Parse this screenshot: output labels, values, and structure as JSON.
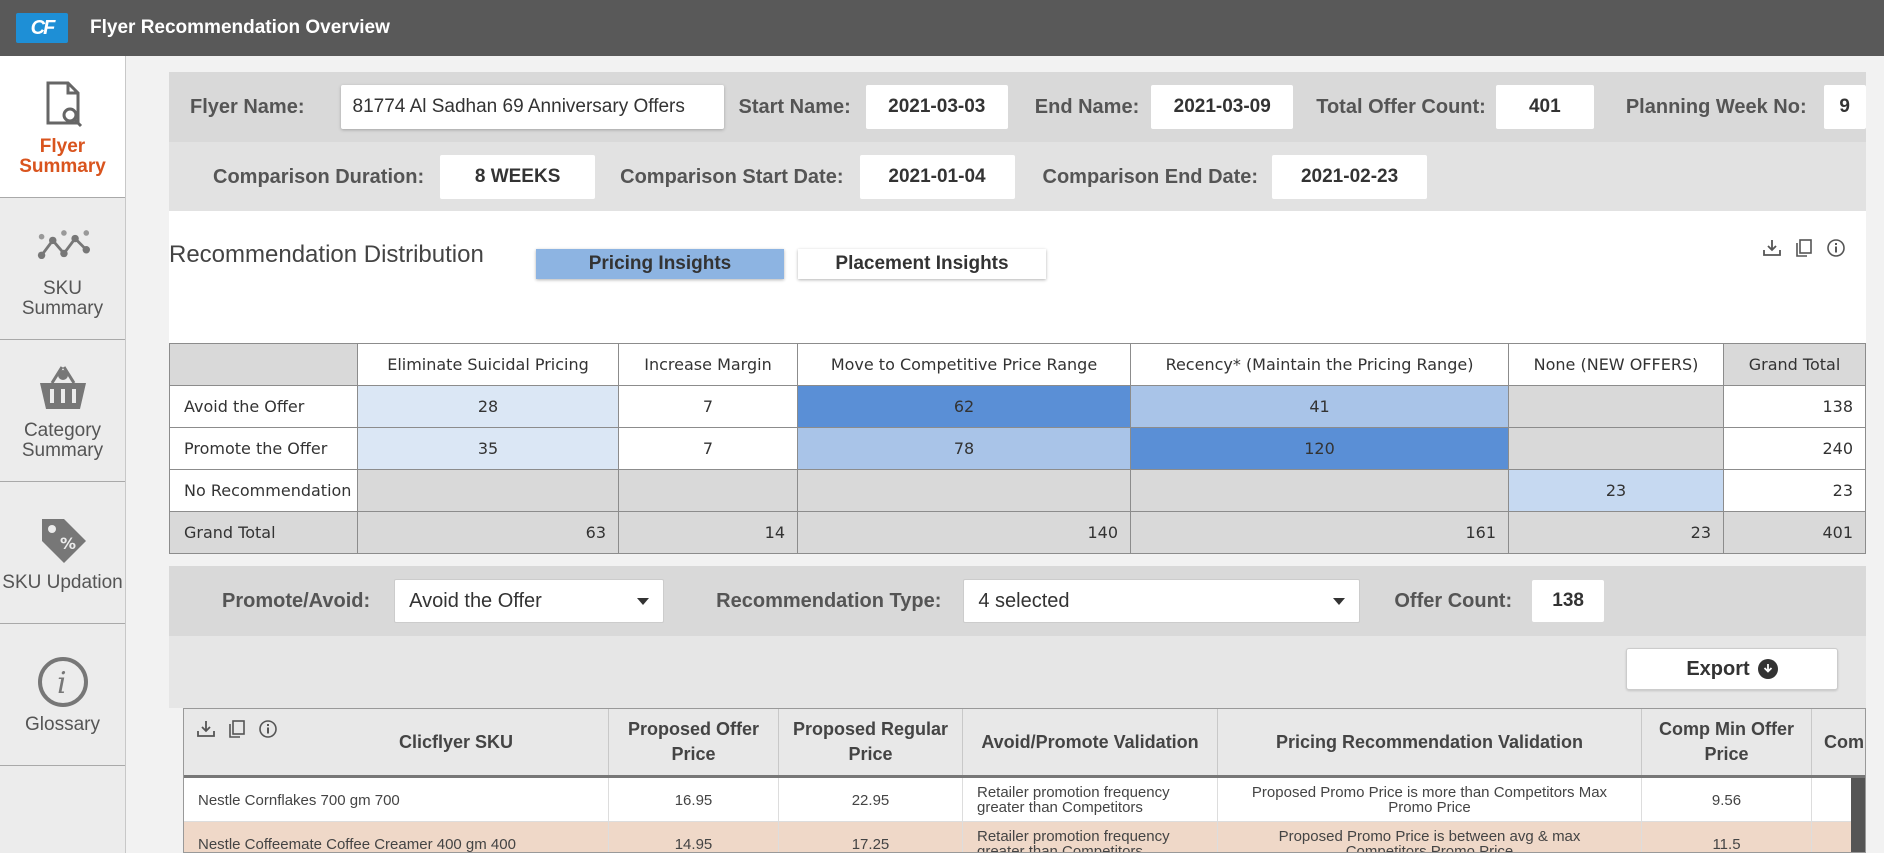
{
  "app": {
    "logo_text": "CF",
    "title": "Flyer Recommendation Overview"
  },
  "sidebar": {
    "items": [
      {
        "label": "Flyer Summary",
        "icon": "document-search-icon",
        "active": true
      },
      {
        "label": "SKU Summary",
        "icon": "network-nodes-icon",
        "active": false
      },
      {
        "label": "Category Summary",
        "icon": "basket-icon",
        "active": false
      },
      {
        "label": "SKU Updation",
        "icon": "price-tag-icon",
        "active": false
      },
      {
        "label": "Glossary",
        "icon": "info-circle-icon",
        "active": false
      }
    ]
  },
  "flyer": {
    "name_label": "Flyer Name:",
    "name_value": "81774 Al Sadhan 69 Anniversary Offers",
    "start_label": "Start Name:",
    "start_value": "2021-03-03",
    "end_label": "End Name:",
    "end_value": "2021-03-09",
    "total_label": "Total Offer Count:",
    "total_value": "401",
    "week_label": "Planning Week No:",
    "week_value": "9"
  },
  "comparison": {
    "duration_label": "Comparison Duration:",
    "duration_value": "8 WEEKS",
    "start_label": "Comparison Start Date:",
    "start_value": "2021-01-04",
    "end_label": "Comparison End Date:",
    "end_value": "2021-02-23"
  },
  "distribution": {
    "title": "Recommendation Distribution",
    "tabs": {
      "pricing": "Pricing Insights",
      "placement": "Placement Insights"
    },
    "columns": [
      "Eliminate Suicidal Pricing",
      "Increase Margin",
      "Move to Competitive Price Range",
      "Recency* (Maintain the Pricing Range)",
      "None (NEW OFFERS)",
      "Grand Total"
    ],
    "rows": [
      {
        "label": "Avoid the Offer",
        "cells": [
          "28",
          "7",
          "62",
          "41",
          "",
          "138"
        ]
      },
      {
        "label": "Promote the Offer",
        "cells": [
          "35",
          "7",
          "78",
          "120",
          "",
          "240"
        ]
      },
      {
        "label": "No Recommendation",
        "cells": [
          "",
          "",
          "",
          "",
          "23",
          "23"
        ]
      },
      {
        "label": "Grand Total",
        "cells": [
          "63",
          "14",
          "140",
          "161",
          "23",
          "401"
        ]
      }
    ]
  },
  "filters": {
    "promote_label": "Promote/Avoid:",
    "promote_value": "Avoid the Offer",
    "type_label": "Recommendation Type:",
    "type_value": "4 selected",
    "count_label": "Offer Count:",
    "count_value": "138"
  },
  "export": {
    "label": "Export"
  },
  "grid": {
    "columns": [
      "Clicflyer SKU",
      "Proposed Offer Price",
      "Proposed Regular Price",
      "Avoid/Promote Validation",
      "Pricing Recommendation Validation",
      "Comp Min Offer Price",
      "Com"
    ],
    "rows": [
      {
        "sku": "Nestle Cornflakes 700 gm 700",
        "offer": "16.95",
        "regular": "22.95",
        "validation": "Retailer promotion frequency greater than Competitors",
        "pricing": "Proposed Promo Price is more than Competitors Max Promo Price",
        "comp_min": "9.56"
      },
      {
        "sku": "Nestle Coffeemate Coffee Creamer 400 gm 400",
        "offer": "14.95",
        "regular": "17.25",
        "validation": "Retailer promotion frequency greater than Competitors",
        "pricing": "Proposed Promo Price is between avg & max Competitors Promo Price",
        "comp_min": "11.5"
      }
    ]
  }
}
